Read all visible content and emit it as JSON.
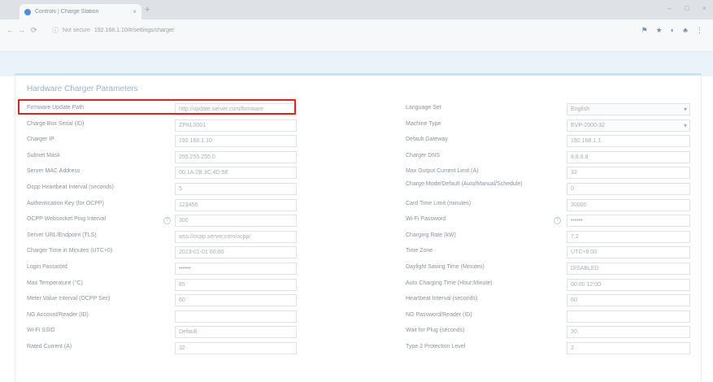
{
  "browser": {
    "tab_title": "Controls | Charge Station",
    "tab_close": "×",
    "new_tab": "+",
    "window_controls": [
      "–",
      "□",
      "×"
    ],
    "back": "←",
    "forward": "→",
    "reload": "⟳",
    "not_secure": "Not secure",
    "url": "192.168.1.10/#/settings/charger",
    "extensions": [
      "⚑",
      "★",
      "◐",
      "♣",
      "⋮"
    ]
  },
  "panel": {
    "title": "Hardware Charger Parameters",
    "left_rows": [
      {
        "label": "Firmware Update Path",
        "value": "http://update.server.com/firmware",
        "kind": "input"
      },
      {
        "label": "Charge Box Serial (ID)",
        "value": "ZPKL0001",
        "kind": "input"
      },
      {
        "label": "Charger IP",
        "value": "192.168.1.10",
        "kind": "input"
      },
      {
        "label": "Subnet Mask",
        "value": "255.255.255.0",
        "kind": "input"
      },
      {
        "label": "Server MAC Address",
        "value": "00:1A:2B:3C:4D:5E",
        "kind": "input"
      },
      {
        "label": "Ocpp Heartbeat Interval (seconds)",
        "value": "5",
        "kind": "input"
      },
      {
        "label": "Authentication Key (for OCPP)",
        "value": "123456",
        "kind": "input"
      },
      {
        "label": "OCPP Websocket Ping Interval",
        "value": "300",
        "kind": "input",
        "hint": "?"
      },
      {
        "label": "Server URL/Endpoint (TLS)",
        "value": "wss://ocpp.server.com/ocpp/",
        "kind": "input"
      },
      {
        "label": "Charger Time in Minutes (UTC+0)",
        "value": "2023-01-01 00:00",
        "kind": "input"
      },
      {
        "label": "Login Password",
        "value": "••••••",
        "kind": "input"
      },
      {
        "label": "Max Temperature (°C)",
        "value": "85",
        "kind": "input"
      },
      {
        "label": "Meter Value Interval (OCPP Sec)",
        "value": "60",
        "kind": "input"
      },
      {
        "label": "NG Account/Reader (ID)",
        "value": "",
        "kind": "input"
      },
      {
        "label": "Wi-Fi SSID",
        "value": "Default",
        "kind": "input"
      },
      {
        "label": "Rated Current (A)",
        "value": "32",
        "kind": "input"
      }
    ],
    "right_rows": [
      {
        "label": "Language Set",
        "value": "English",
        "kind": "select"
      },
      {
        "label": "Machine Type",
        "value": "EVP-2000-32",
        "kind": "select"
      },
      {
        "label": "Default Gateway",
        "value": "192.168.1.1",
        "kind": "input"
      },
      {
        "label": "Charger DNS",
        "value": "8.8.8.8",
        "kind": "input"
      },
      {
        "label": "Max Output Current Limit (A)",
        "value": "32",
        "kind": "input"
      },
      {
        "label": "Charge Mode/Default (Auto/Manual/Schedule)",
        "value": "0",
        "kind": "input",
        "two_line": true
      },
      {
        "label": "Card Time Limit (minutes)",
        "value": "30000",
        "kind": "input"
      },
      {
        "label": "Wi-Fi Password",
        "value": "••••••",
        "kind": "input",
        "hint": "?"
      },
      {
        "label": "Charging Rate (kW)",
        "value": "7.2",
        "kind": "input"
      },
      {
        "label": "Time Zone",
        "value": "UTC+8:00",
        "kind": "input"
      },
      {
        "label": "Daylight Saving Time (Minutes)",
        "value": "DISABLED",
        "kind": "input"
      },
      {
        "label": "Auto Charging Time (Hour:Minute)",
        "value": "00:00 12:00",
        "kind": "input"
      },
      {
        "label": "Heartbeat Interval (seconds)",
        "value": "60",
        "kind": "input"
      },
      {
        "label": "NG Password/Reader (ID)",
        "value": "",
        "kind": "input"
      },
      {
        "label": "Wait for Plug (seconds)",
        "value": "30",
        "kind": "input"
      },
      {
        "label": "Type 2 Protection Level",
        "value": "2",
        "kind": "input"
      }
    ]
  },
  "colors": {
    "highlight": "#e0241b",
    "panel_border": "#cfe0f1",
    "title_text": "#9bb3cc"
  }
}
